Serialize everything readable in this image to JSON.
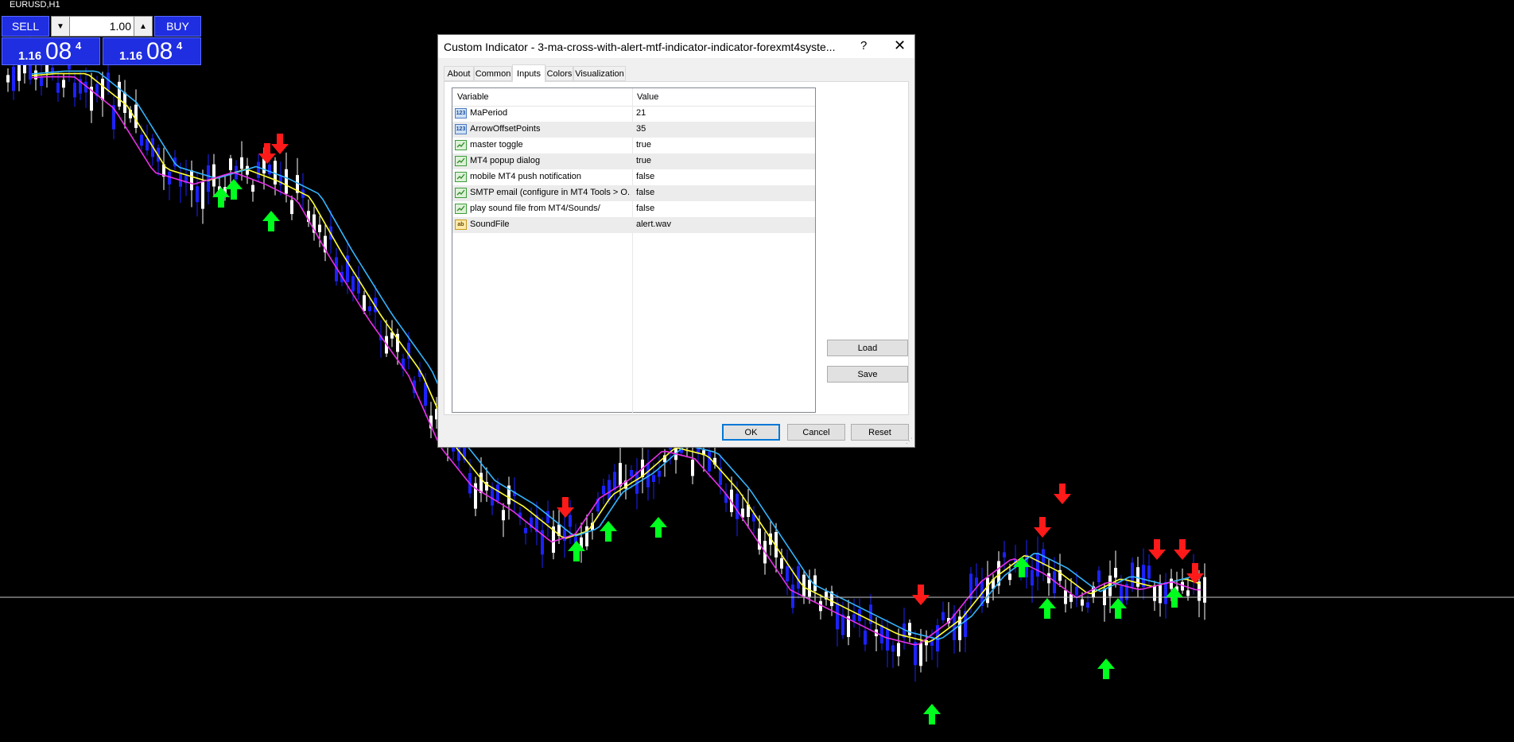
{
  "chart": {
    "symbol": "EURUSD,H1",
    "colors": {
      "background": "#000000",
      "bull_candle": "#ffffff",
      "bear_candle": "#1c22ff",
      "ma_fast": "#ffff33",
      "ma_mid": "#33b5ff",
      "ma_slow": "#e830e8",
      "arrow_up": "#00ff1e",
      "arrow_down": "#ff1a1a",
      "price_line": "#c8c8c8"
    }
  },
  "trade_panel": {
    "sell_label": "SELL",
    "buy_label": "BUY",
    "lot_value": "1.00",
    "sell_price_prefix": "1.16",
    "sell_price_big": "08",
    "sell_price_sup": "4",
    "buy_price_prefix": "1.16",
    "buy_price_big": "08",
    "buy_price_sup": "4"
  },
  "dialog": {
    "title": "Custom Indicator - 3-ma-cross-with-alert-mtf-indicator-indicator-forexmt4syste...",
    "help_label": "?",
    "close_label": "✕",
    "tabs": [
      "About",
      "Common",
      "Inputs",
      "Colors",
      "Visualization"
    ],
    "active_tab": "Inputs",
    "grid": {
      "col_variable": "Variable",
      "col_value": "Value",
      "rows": [
        {
          "type": "num",
          "icon_text": "123",
          "variable": "MaPeriod",
          "value": "21"
        },
        {
          "type": "num",
          "icon_text": "123",
          "variable": "ArrowOffsetPoints",
          "value": "35"
        },
        {
          "type": "bool",
          "icon_text": "",
          "variable": "master toggle",
          "value": "true"
        },
        {
          "type": "bool",
          "icon_text": "",
          "variable": "MT4 popup dialog",
          "value": "true"
        },
        {
          "type": "bool",
          "icon_text": "",
          "variable": "mobile MT4 push notification",
          "value": "false"
        },
        {
          "type": "bool",
          "icon_text": "",
          "variable": "SMTP email (configure in MT4 Tools > O...",
          "value": "false"
        },
        {
          "type": "bool",
          "icon_text": "",
          "variable": "play sound file from MT4/Sounds/",
          "value": "false"
        },
        {
          "type": "str",
          "icon_text": "ab",
          "variable": "SoundFile",
          "value": "alert.wav"
        }
      ]
    },
    "load_label": "Load",
    "save_label": "Save",
    "ok_label": "OK",
    "cancel_label": "Cancel",
    "reset_label": "Reset"
  }
}
